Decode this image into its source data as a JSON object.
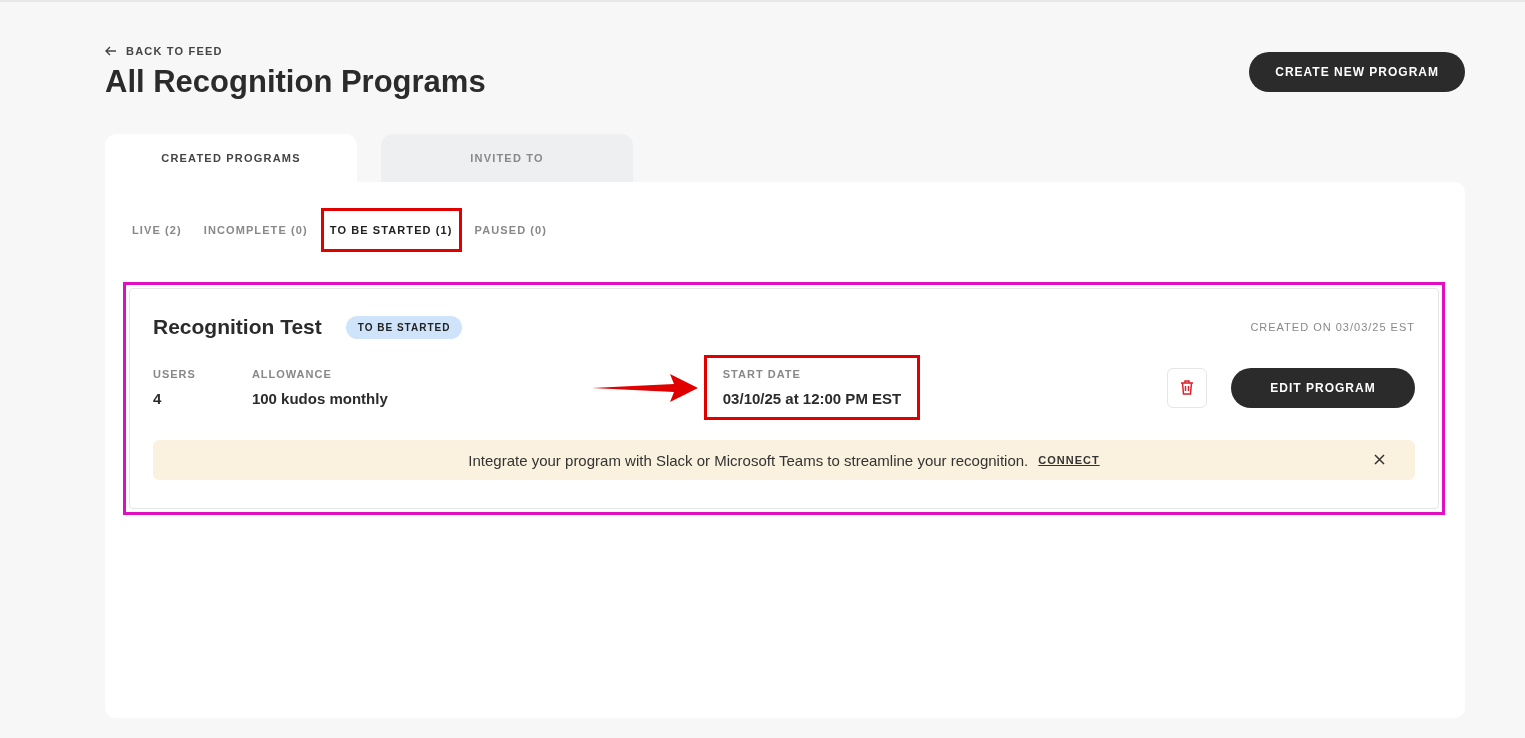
{
  "back_link": {
    "label": "BACK TO FEED"
  },
  "page_title": "All Recognition Programs",
  "create_button": "CREATE NEW PROGRAM",
  "tabs": [
    {
      "label": "CREATED PROGRAMS",
      "selected": true
    },
    {
      "label": "INVITED TO",
      "selected": false
    }
  ],
  "filters": [
    {
      "label": "LIVE (2)",
      "selected": false
    },
    {
      "label": "INCOMPLETE (0)",
      "selected": false
    },
    {
      "label": "TO BE STARTED (1)",
      "selected": true,
      "annotation": {
        "kind": "box",
        "color": "#e00000"
      }
    },
    {
      "label": "PAUSED (0)",
      "selected": false
    }
  ],
  "programs": [
    {
      "name": "Recognition Test",
      "status": "TO BE STARTED",
      "created": "CREATED ON 03/03/25 EST",
      "annotation": {
        "kind": "box",
        "color": "#e010c0"
      },
      "stats": [
        {
          "label": "USERS",
          "value": "4"
        },
        {
          "label": "ALLOWANCE",
          "value": "100 kudos monthly"
        }
      ],
      "start_date": {
        "label": "START DATE",
        "value": "03/10/25 at 12:00 PM EST",
        "arrow": {
          "color": "#e00000"
        },
        "annotation": {
          "kind": "box",
          "color": "#e00000"
        }
      },
      "edit_button": "EDIT PROGRAM",
      "banner": {
        "text": "Integrate your program with Slack or Microsoft Teams to streamline your recognition.",
        "link": "CONNECT"
      }
    }
  ]
}
